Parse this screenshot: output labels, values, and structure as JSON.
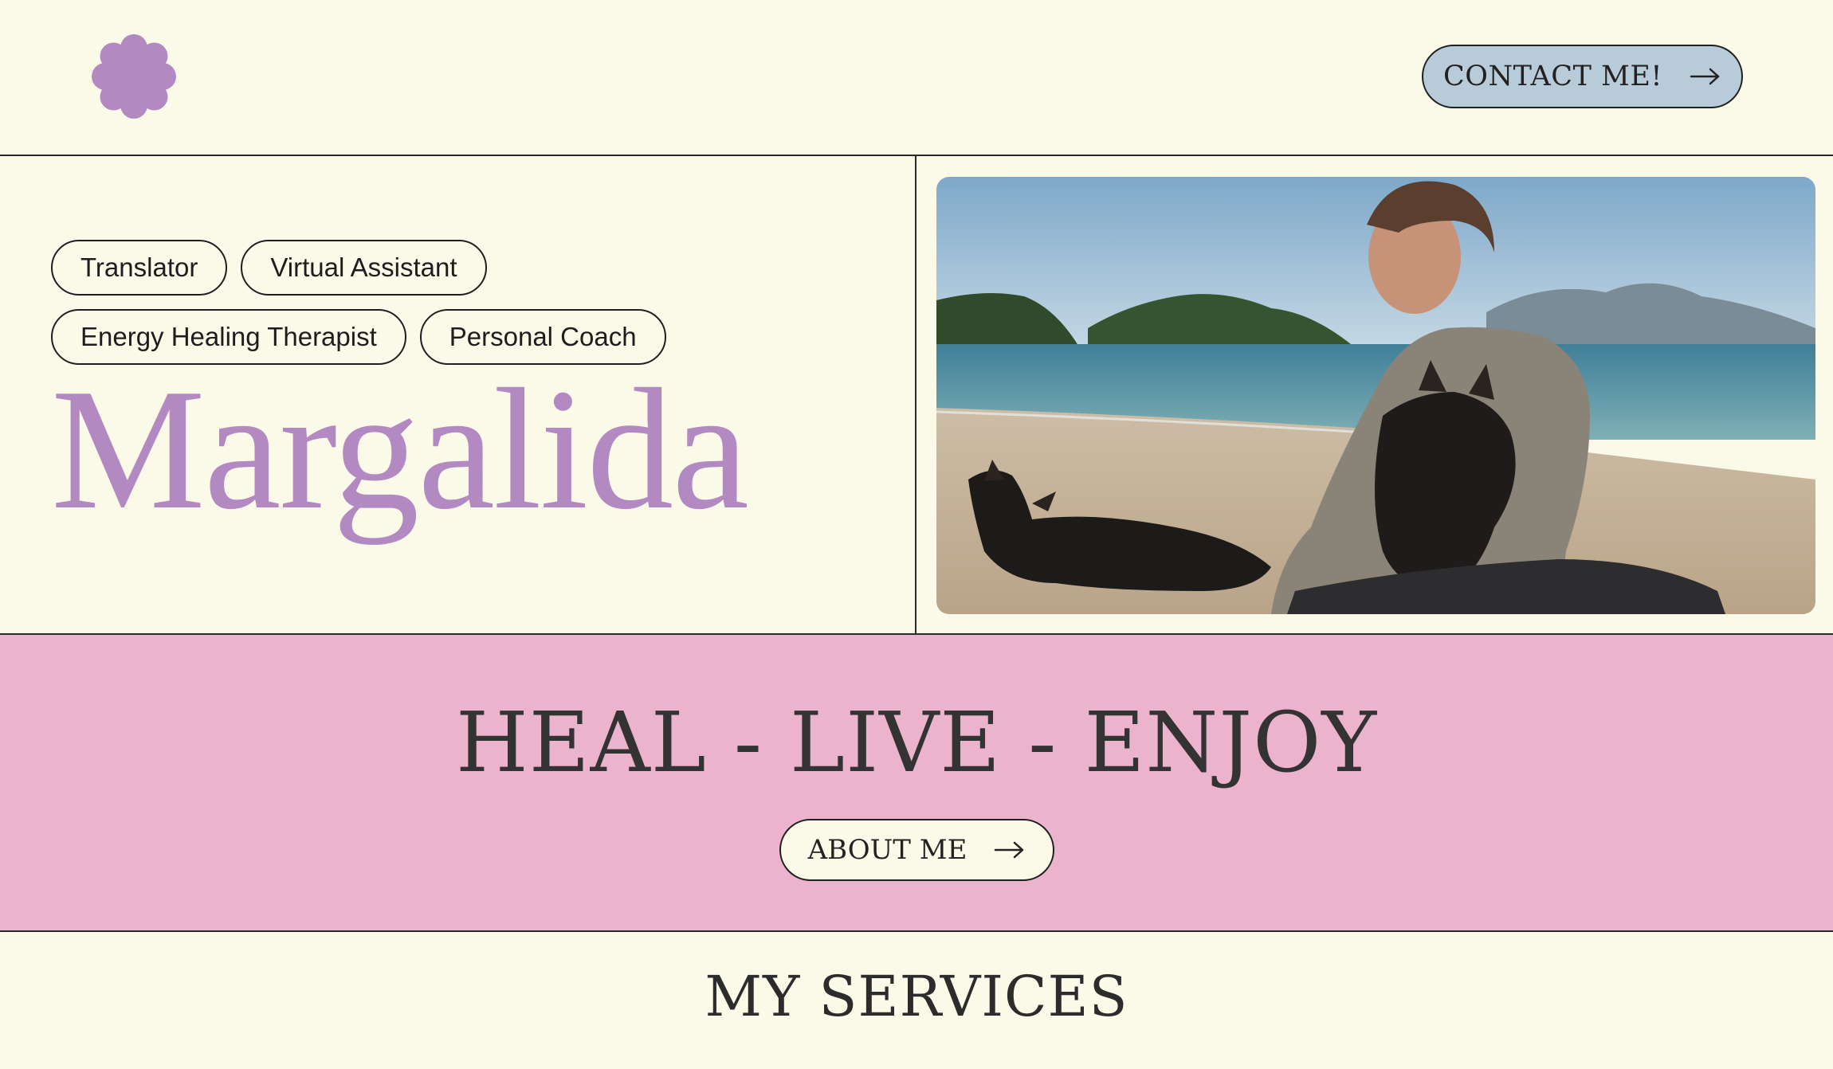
{
  "header": {
    "logo_icon": "flower-icon",
    "logo_color": "#b389c2",
    "contact_label": "CONTACT ME!",
    "contact_bg": "#b8cbd8"
  },
  "hero": {
    "tags": [
      "Translator",
      "Virtual Assistant",
      "Energy Healing Therapist",
      "Personal Coach"
    ],
    "name": "Margalida",
    "name_color": "#b389c2",
    "photo_subject": "woman-with-dogs-on-beach"
  },
  "band": {
    "tagline": "HEAL - LIVE - ENJOY",
    "about_label": "ABOUT ME",
    "bg": "#ecb3cc"
  },
  "services": {
    "title": "MY SERVICES"
  },
  "icons": {
    "arrow": "arrow-right-icon"
  }
}
